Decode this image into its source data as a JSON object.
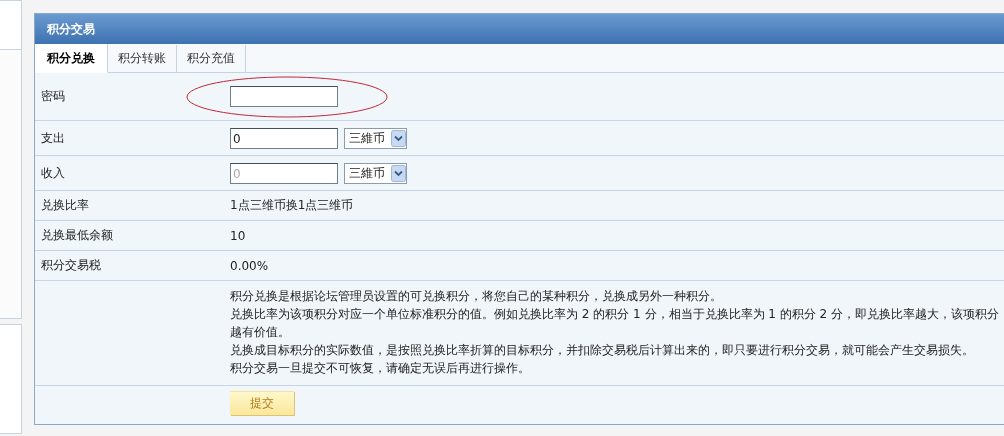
{
  "panel": {
    "title": "积分交易"
  },
  "tabs": [
    {
      "label": "积分兑换",
      "selected": true
    },
    {
      "label": "积分转账",
      "selected": false
    },
    {
      "label": "积分充值",
      "selected": false
    }
  ],
  "rows": [
    {
      "kind": "input",
      "label": "密码",
      "highlighted": true
    },
    {
      "kind": "input_select",
      "label": "支出",
      "value": "0",
      "disabled": false,
      "select": "三維币"
    },
    {
      "kind": "input_select",
      "label": "收入",
      "value": "0",
      "disabled": true,
      "select": "三維币"
    },
    {
      "kind": "text",
      "label": "兑换比率",
      "value": "1点三维币换1点三维币"
    },
    {
      "kind": "text",
      "label": "兑换最低余额",
      "value": "10"
    },
    {
      "kind": "text",
      "label": "积分交易税",
      "value": "0.00%"
    },
    {
      "kind": "notes",
      "lines": [
        "积分兑换是根据论坛管理员设置的可兑换积分，将您自己的某种积分，兑换成另外一种积分。",
        "兑换比率为该项积分对应一个单位标准积分的值。例如兑换比率为  2 的积分  1 分，相当于兑换比率为  1 的积分  2 分，即兑换比率越大，该项积分",
        "越有价值。",
        "兑换成目标积分的实际数值，是按照兑换比率折算的目标积分，并扣除交易税后计算出来的，即只要进行积分交易，就可能会产生交易损失。",
        "积分交易一旦提交不可恢复，请确定无误后再进行操作。"
      ]
    }
  ],
  "submit": "提交"
}
